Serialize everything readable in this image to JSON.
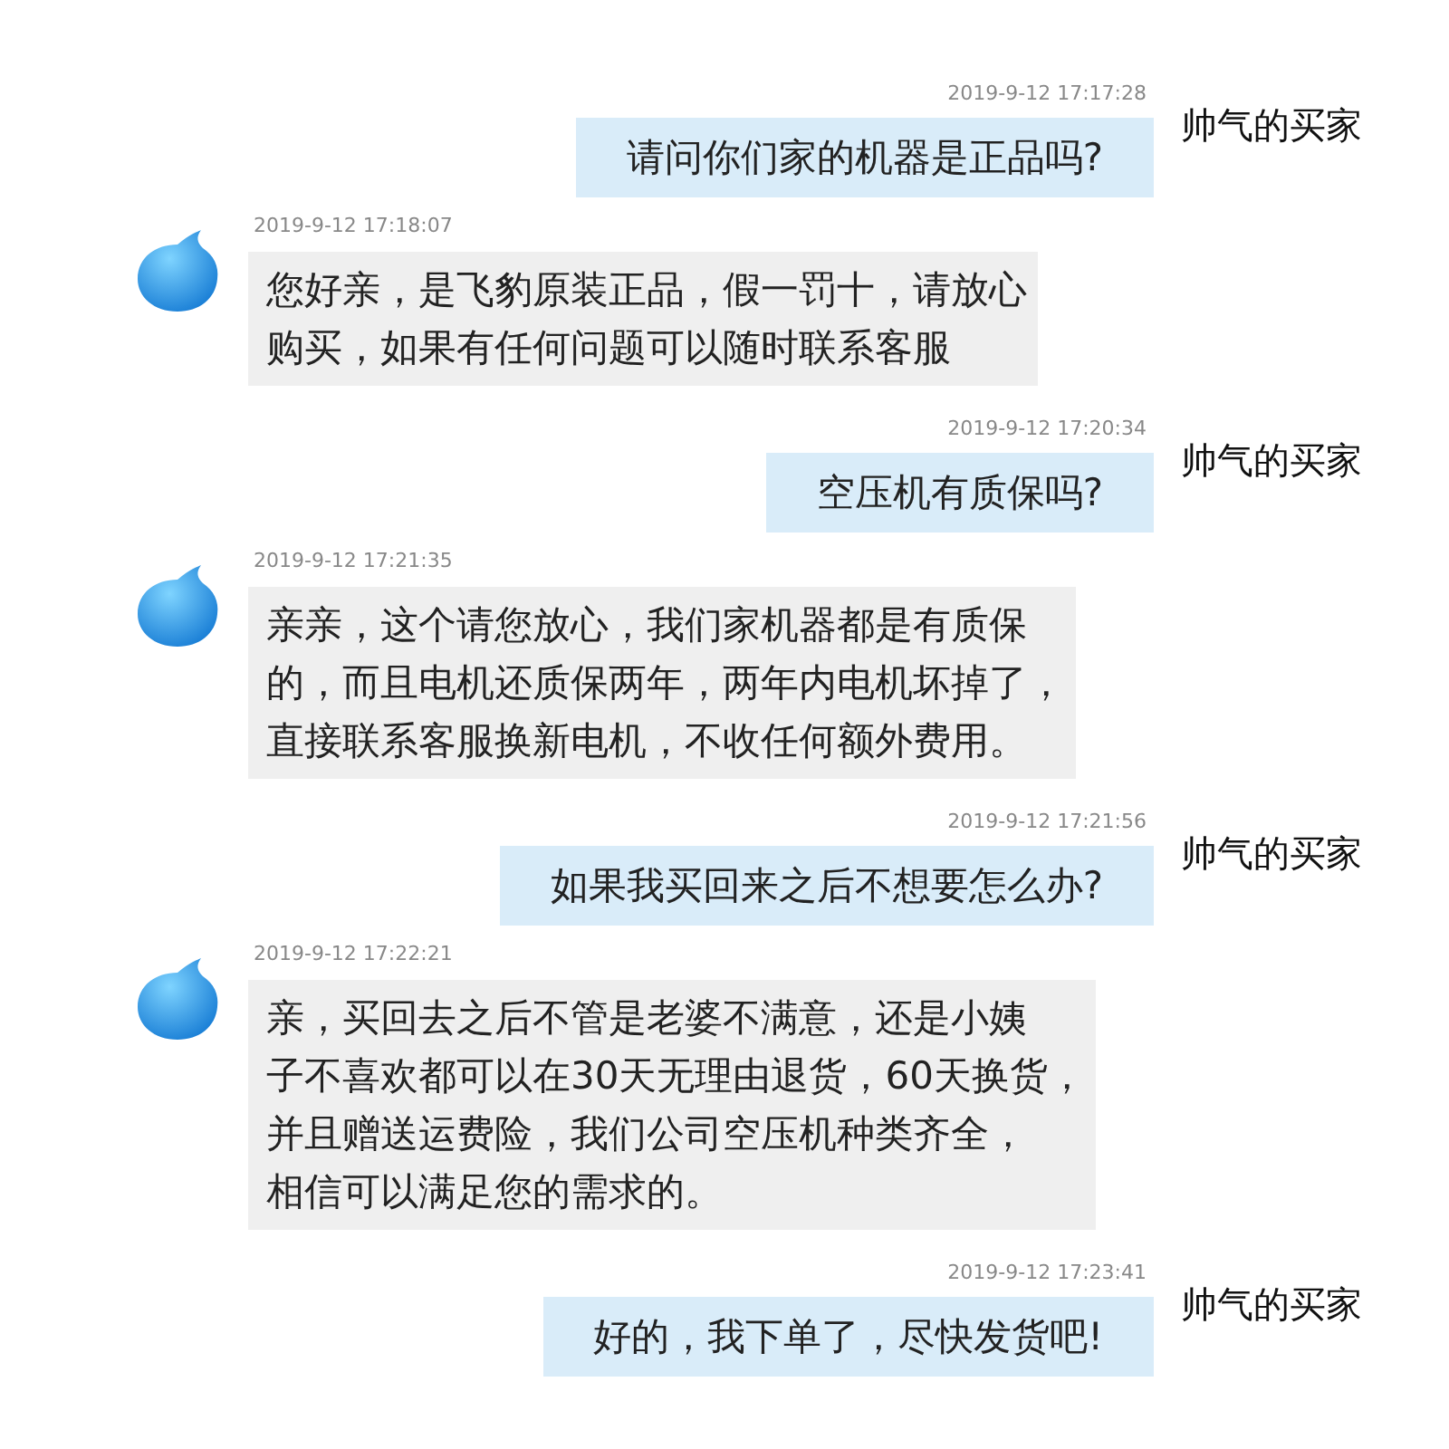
{
  "messages": [
    {
      "kind": "buyer",
      "time": "2019-9-12 17:17:28",
      "lines": [
        "请问你们家的机器是正品吗?"
      ],
      "sender": "帅气的买家"
    },
    {
      "kind": "seller",
      "time": "2019-9-12 17:18:07",
      "lines": [
        "您好亲，是飞豹原装正品，假一罚十，请放心",
        "购买，如果有任何问题可以随时联系客服"
      ]
    },
    {
      "kind": "buyer",
      "time": "2019-9-12 17:20:34",
      "lines": [
        "空压机有质保吗?"
      ],
      "sender": "帅气的买家"
    },
    {
      "kind": "seller",
      "time": "2019-9-12 17:21:35",
      "lines": [
        "亲亲，这个请您放心，我们家机器都是有质保",
        "的，而且电机还质保两年，两年内电机坏掉了，",
        "直接联系客服换新电机，不收任何额外费用。"
      ]
    },
    {
      "kind": "buyer",
      "time": "2019-9-12 17:21:56",
      "lines": [
        "如果我买回来之后不想要怎么办?"
      ],
      "sender": "帅气的买家"
    },
    {
      "kind": "seller",
      "time": "2019-9-12 17:22:21",
      "lines": [
        "亲，买回去之后不管是老婆不满意，还是小姨",
        "子不喜欢都可以在30天无理由退货，60天换货，",
        "并且赠送运费险，我们公司空压机种类齐全，",
        "相信可以满足您的需求的。"
      ]
    },
    {
      "kind": "buyer",
      "time": "2019-9-12 17:23:41",
      "lines": [
        "好的，我下单了，尽快发货吧!"
      ],
      "sender": "帅气的买家"
    }
  ]
}
